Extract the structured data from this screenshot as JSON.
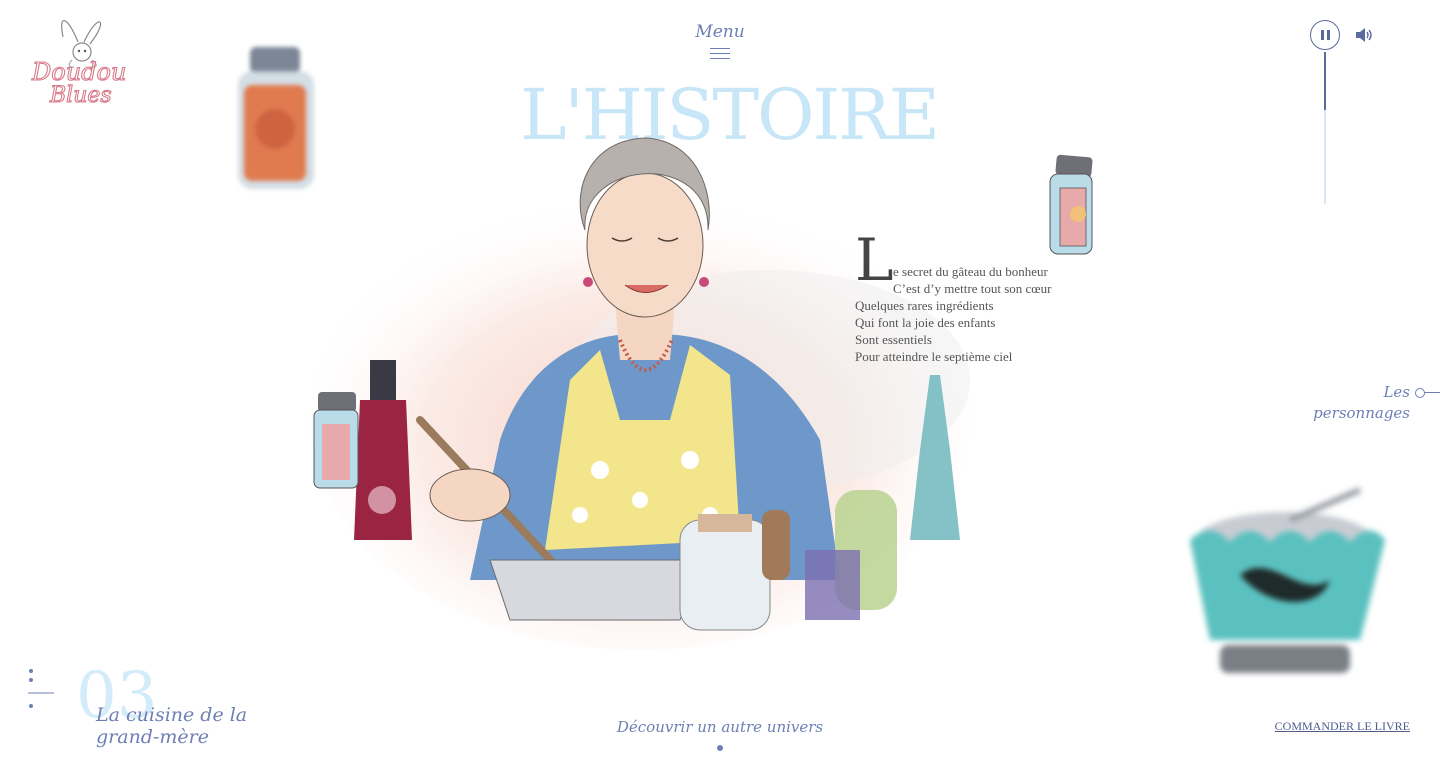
{
  "logo": {
    "line1": "Doudou",
    "line2": "Blues"
  },
  "menu": {
    "label": "Menu"
  },
  "page": {
    "title": "L'HISTOIRE"
  },
  "poem": {
    "dropcap": "L",
    "lines": [
      "e secret du gâteau du bonheur",
      "C’est d’y mettre tout son cœur",
      "Quelques rares ingrédients",
      "Qui font la joie des enfants",
      "Sont essentiels",
      "Pour atteindre le septième ciel"
    ]
  },
  "audio": {
    "progress": 0.38
  },
  "nav": {
    "characters_line1": "Les",
    "characters_line2": "personnages",
    "discover": "Découvrir un autre univers",
    "order": "COMMANDER LE LIVRE"
  },
  "chapter": {
    "number": "03",
    "title_line1": "La cuisine de la",
    "title_line2": "grand-mère"
  },
  "colors": {
    "accent": "#6e7fb5",
    "title": "#c7e6f7",
    "text": "#555555"
  }
}
